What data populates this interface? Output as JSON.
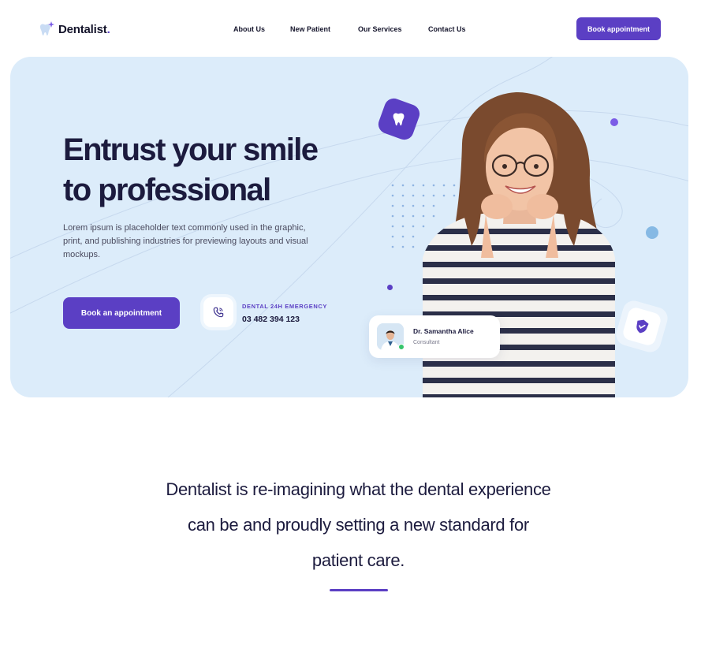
{
  "brand": {
    "name": "Dentalist",
    "dot": ".",
    "accent": "#5b3fc4",
    "hero_bg": "#dcecfa"
  },
  "nav": {
    "links": [
      "About Us",
      "New Patient",
      "Our Services",
      "Contact Us"
    ],
    "cta": "Book appointment"
  },
  "hero": {
    "title_lines": [
      "Entrust your smile",
      "to professional"
    ],
    "description": "Lorem ipsum is placeholder text commonly used in the graphic, print, and publishing industries for previewing layouts and visual mockups.",
    "cta": "Book an appointment",
    "emergency_label": "DENTAL 24H EMERGENCY",
    "emergency_phone": "03 482 394 123",
    "icons": [
      "tooth-icon",
      "phone-icon",
      "shield-check-icon"
    ]
  },
  "doctor": {
    "name": "Dr. Samantha Alice",
    "role": "Consultant",
    "status": "online"
  },
  "statement": {
    "lines": [
      "Dentalist is re-imagining what the dental experience",
      "can be and proudly setting a new standard for",
      "patient care."
    ]
  }
}
